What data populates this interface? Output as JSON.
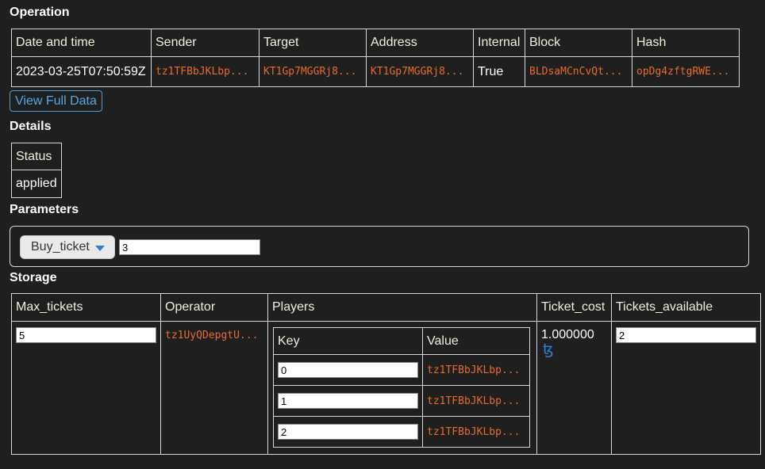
{
  "operation": {
    "heading": "Operation",
    "columns": [
      "Date and time",
      "Sender",
      "Target",
      "Address",
      "Internal",
      "Block",
      "Hash"
    ],
    "row": {
      "datetime": "2023-03-25T07:50:59Z",
      "sender": "tz1TFBbJKLbp...",
      "target": "KT1Gp7MGGRj8...",
      "address": "KT1Gp7MGGRj8...",
      "internal": "True",
      "block": "BLDsaMCnCvQt...",
      "hash": "opDg4zftgRWE..."
    },
    "view_full_label": "View Full Data"
  },
  "details": {
    "heading": "Details",
    "status_label": "Status",
    "status_value": "applied"
  },
  "parameters": {
    "heading": "Parameters",
    "entrypoint": "Buy_ticket",
    "value": "3"
  },
  "storage": {
    "heading": "Storage",
    "columns": [
      "Max_tickets",
      "Operator",
      "Players",
      "Ticket_cost",
      "Tickets_available"
    ],
    "max_tickets": "5",
    "operator": "tz1UyQDepgtU...",
    "players": {
      "columns": [
        "Key",
        "Value"
      ],
      "rows": [
        {
          "key": "0",
          "value": "tz1TFBbJKLbp..."
        },
        {
          "key": "1",
          "value": "tz1TFBbJKLbp..."
        },
        {
          "key": "2",
          "value": "tz1TFBbJKLbp..."
        }
      ]
    },
    "ticket_cost": "1.000000",
    "tez_icon": "ꜩ",
    "tickets_available": "2"
  },
  "colors": {
    "background": "#1f1f1f",
    "address_text": "#e86b2c",
    "link_blue": "#57a9e6",
    "tez_blue": "#2b7fd6"
  }
}
